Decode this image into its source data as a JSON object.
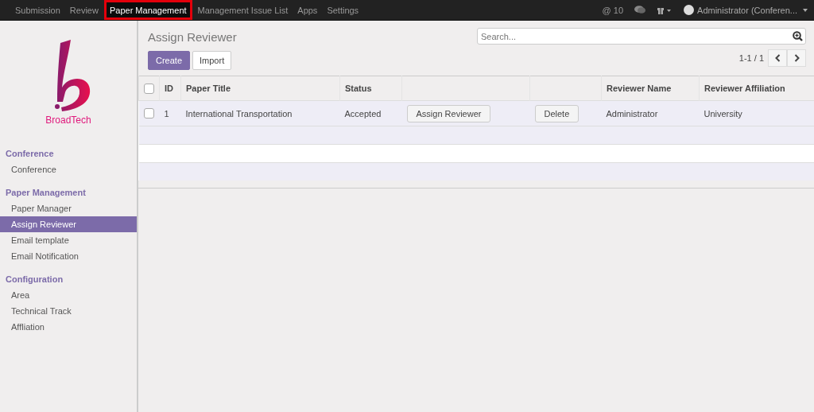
{
  "top_menu": [
    {
      "label": "Submission",
      "selected": false
    },
    {
      "label": "Review",
      "selected": false
    },
    {
      "label": "Paper Management",
      "selected": true
    },
    {
      "label": "Management Issue List",
      "selected": false
    },
    {
      "label": "Apps",
      "selected": false
    },
    {
      "label": "Settings",
      "selected": false
    }
  ],
  "top_right": {
    "mentions": "@ 10",
    "user": "Administrator (Conferen..."
  },
  "logo": {
    "text": "BroadTech"
  },
  "sidebar": {
    "sections": [
      {
        "title": "Conference",
        "items": [
          {
            "label": "Conference",
            "selected": false
          }
        ]
      },
      {
        "title": "Paper Management",
        "items": [
          {
            "label": "Paper Manager",
            "selected": false
          },
          {
            "label": "Assign Reviewer",
            "selected": true
          },
          {
            "label": "Email template",
            "selected": false
          },
          {
            "label": "Email Notification",
            "selected": false
          }
        ]
      },
      {
        "title": "Configuration",
        "items": [
          {
            "label": "Area",
            "selected": false
          },
          {
            "label": "Technical Track",
            "selected": false
          },
          {
            "label": "Affliation",
            "selected": false
          }
        ]
      }
    ]
  },
  "page": {
    "title": "Assign Reviewer",
    "buttons": [
      {
        "label": "Create",
        "kind": "primary"
      },
      {
        "label": "Import",
        "kind": "default"
      }
    ],
    "search": {
      "placeholder": "Search..."
    },
    "pager": "1-1 / 1"
  },
  "table": {
    "select_all_checked": false,
    "columns": [
      "ID",
      "Paper Title",
      "Status",
      "",
      "",
      "Reviewer Name",
      "Reviewer Affiliation"
    ],
    "rows": [
      {
        "checked": false,
        "id": "1",
        "paper_title": "International Transportation",
        "status": "Accepted",
        "assign_button": "Assign Reviewer",
        "delete_button": "Delete",
        "reviewer_name": "Administrator",
        "reviewer_affiliation": "University"
      }
    ]
  }
}
